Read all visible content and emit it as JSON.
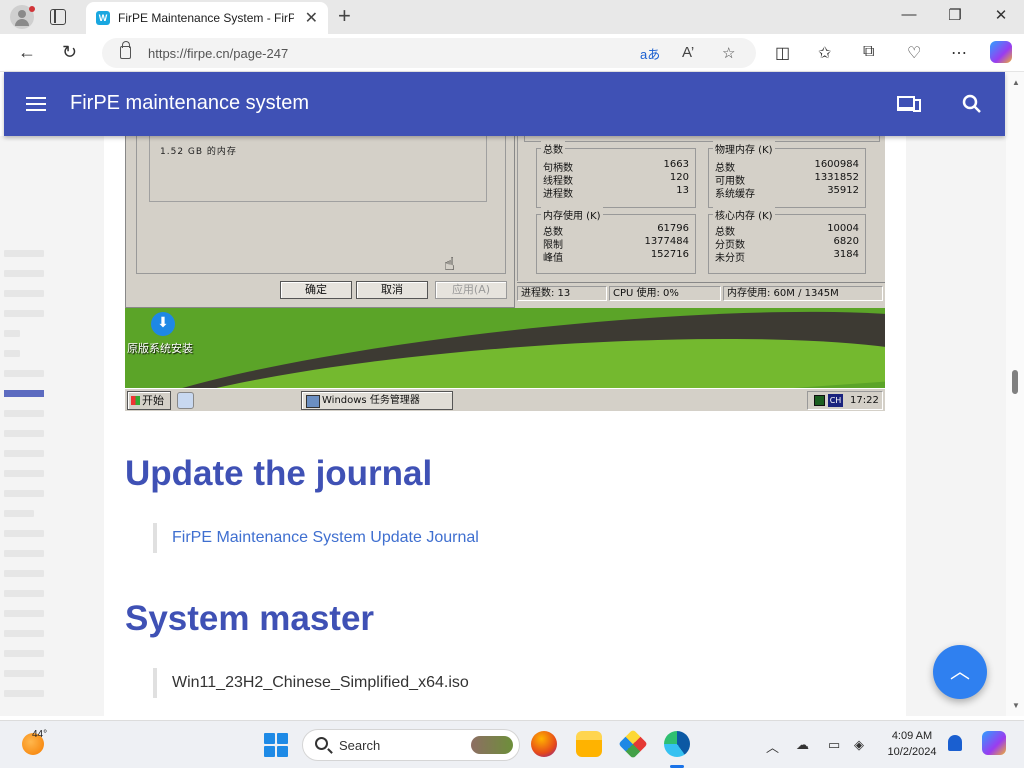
{
  "browser": {
    "tab_title": "FirPE Maintenance System - FirPE",
    "tab_favicon": "W",
    "url": "https://firpe.cn/page-247",
    "translate_icon": "aあ",
    "read_aloud_icon": "A’"
  },
  "site": {
    "title": "FirPE maintenance system"
  },
  "screenshot": {
    "memory_text": "1.52 GB 的内存",
    "buttons": {
      "ok": "确定",
      "cancel": "取消",
      "apply": "应用(A)"
    },
    "groups": [
      {
        "title": "总数",
        "rows": [
          [
            "句柄数",
            "1663"
          ],
          [
            "线程数",
            "120"
          ],
          [
            "进程数",
            "13"
          ]
        ]
      },
      {
        "title": "物理内存 (K)",
        "rows": [
          [
            "总数",
            "1600984"
          ],
          [
            "可用数",
            "1331852"
          ],
          [
            "系统缓存",
            "35912"
          ]
        ]
      },
      {
        "title": "内存使用 (K)",
        "rows": [
          [
            "总数",
            "61796"
          ],
          [
            "限制",
            "1377484"
          ],
          [
            "峰值",
            "152716"
          ]
        ]
      },
      {
        "title": "核心内存 (K)",
        "rows": [
          [
            "总数",
            "10004"
          ],
          [
            "分页数",
            "6820"
          ],
          [
            "未分页",
            "3184"
          ]
        ]
      }
    ],
    "status": {
      "processes": "进程数: 13",
      "cpu": "CPU 使用: 0%",
      "memory": "内存使用: 60M / 1345M"
    },
    "desktop_icon_label": "原版系统安装",
    "start_label": "开始",
    "task_label": "Windows 任务管理器",
    "tray_ch": "CH",
    "tray_time": "17:22"
  },
  "article": {
    "heading1": "Update the journal",
    "link1": "FirPE Maintenance System Update Journal",
    "heading2": "System master",
    "item2": "Win11_23H2_Chinese_Simplified_x64.iso"
  },
  "fab": {
    "icon": "chevron-up-icon"
  },
  "taskbar": {
    "weather_temp": "44°",
    "search_label": "Search",
    "time": "4:09 AM",
    "date": "10/2/2024"
  },
  "colors": {
    "header": "#3f51b5",
    "heading": "#3f51b5",
    "link": "#3f6fd0",
    "fab": "#2f80f0"
  }
}
